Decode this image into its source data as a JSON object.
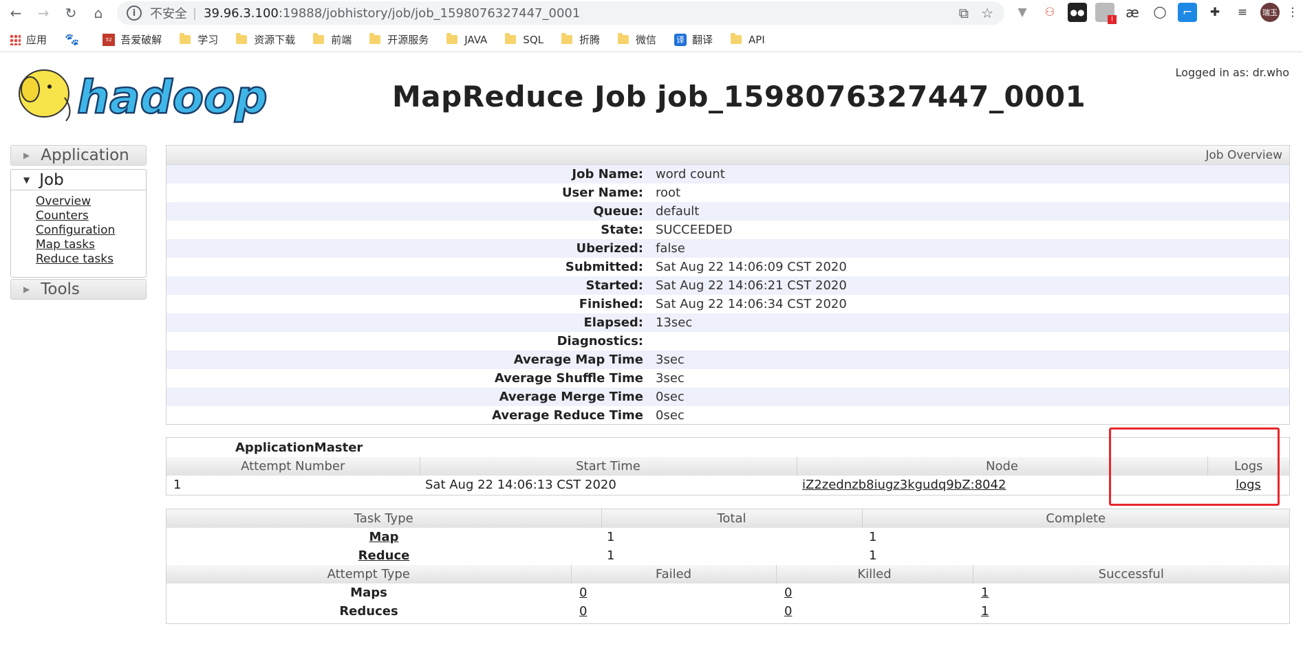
{
  "browser": {
    "insecure_label": "不安全",
    "url_host": "39.96.3.100",
    "url_path": ":19888/jobhistory/job/job_1598076327447_0001",
    "avatar_text": "瑞玉",
    "ext_badge": "!"
  },
  "bookmarks": [
    {
      "label": "应用",
      "icon": "apps-grid-icon"
    },
    {
      "label": "",
      "icon": "paw-icon"
    },
    {
      "label": "吾爱破解",
      "icon": "52pojie-icon"
    },
    {
      "label": "学习",
      "icon": "folder-icon"
    },
    {
      "label": "资源下载",
      "icon": "folder-icon"
    },
    {
      "label": "前端",
      "icon": "folder-icon"
    },
    {
      "label": "开源服务",
      "icon": "folder-icon"
    },
    {
      "label": "JAVA",
      "icon": "folder-icon"
    },
    {
      "label": "SQL",
      "icon": "folder-icon"
    },
    {
      "label": "折腾",
      "icon": "folder-icon"
    },
    {
      "label": "微信",
      "icon": "folder-icon"
    },
    {
      "label": "翻译",
      "icon": "translate-icon"
    },
    {
      "label": "API",
      "icon": "folder-icon"
    }
  ],
  "header": {
    "logo_text": "hadoop",
    "logged_in": "Logged in as: dr.who",
    "title": "MapReduce Job job_1598076327447_0001"
  },
  "sidebar": {
    "application": "Application",
    "job": "Job",
    "job_links": [
      "Overview",
      "Counters",
      "Configuration",
      "Map tasks",
      "Reduce tasks"
    ],
    "tools": "Tools"
  },
  "overview": {
    "heading": "Job Overview",
    "rows": [
      {
        "label": "Job Name:",
        "value": "word count"
      },
      {
        "label": "User Name:",
        "value": "root"
      },
      {
        "label": "Queue:",
        "value": "default"
      },
      {
        "label": "State:",
        "value": "SUCCEEDED"
      },
      {
        "label": "Uberized:",
        "value": "false"
      },
      {
        "label": "Submitted:",
        "value": "Sat Aug 22 14:06:09 CST 2020"
      },
      {
        "label": "Started:",
        "value": "Sat Aug 22 14:06:21 CST 2020"
      },
      {
        "label": "Finished:",
        "value": "Sat Aug 22 14:06:34 CST 2020"
      },
      {
        "label": "Elapsed:",
        "value": "13sec"
      },
      {
        "label": "Diagnostics:",
        "value": ""
      },
      {
        "label": "Average Map Time",
        "value": "3sec"
      },
      {
        "label": "Average Shuffle Time",
        "value": "3sec"
      },
      {
        "label": "Average Merge Time",
        "value": "0sec"
      },
      {
        "label": "Average Reduce Time",
        "value": "0sec"
      }
    ]
  },
  "app_master": {
    "title": "ApplicationMaster",
    "headers": [
      "Attempt Number",
      "Start Time",
      "Node",
      "Logs"
    ],
    "row": {
      "attempt": "1",
      "start": "Sat Aug 22 14:06:13 CST 2020",
      "node": "iZ2zednzb8iugz3kgudq9bZ:8042",
      "logs": "logs"
    }
  },
  "tasks": {
    "headers": [
      "Task Type",
      "Total",
      "Complete"
    ],
    "rows": [
      {
        "type": "Map",
        "total": "1",
        "complete": "1"
      },
      {
        "type": "Reduce",
        "total": "1",
        "complete": "1"
      }
    ],
    "attempt_headers": [
      "Attempt Type",
      "Failed",
      "Killed",
      "Successful"
    ],
    "attempt_rows": [
      {
        "type": "Maps",
        "failed": "0",
        "killed": "0",
        "successful": "1"
      },
      {
        "type": "Reduces",
        "failed": "0",
        "killed": "0",
        "successful": "1"
      }
    ]
  },
  "colors": {
    "highlight_box": "#e8262b",
    "row_stripe": "#eef1fb",
    "logo_yellow": "#f7e34a",
    "logo_blue": "#3fb6e8"
  }
}
